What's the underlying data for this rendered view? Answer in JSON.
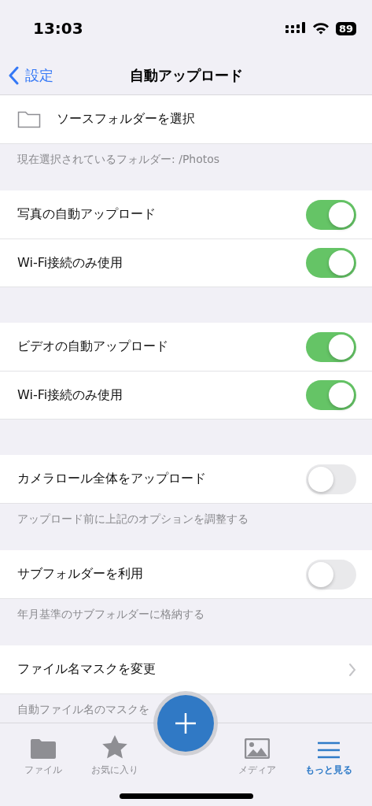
{
  "status_bar": {
    "time": "13:03",
    "battery": "89"
  },
  "nav": {
    "back": "設定",
    "title": "自動アップロード"
  },
  "sections": [
    {
      "rows": [
        {
          "kind": "folder",
          "label": "ソースフォルダーを選択"
        }
      ],
      "footer": "現在選択されているフォルダー: /Photos"
    },
    {
      "rows": [
        {
          "kind": "toggle",
          "label": "写真の自動アップロード",
          "on": true
        },
        {
          "kind": "toggle",
          "label": "Wi-Fi接続のみ使用",
          "on": true
        }
      ]
    },
    {
      "rows": [
        {
          "kind": "toggle",
          "label": "ビデオの自動アップロード",
          "on": true
        },
        {
          "kind": "toggle",
          "label": "Wi-Fi接続のみ使用",
          "on": true
        }
      ]
    },
    {
      "rows": [
        {
          "kind": "toggle",
          "label": "カメラロール全体をアップロード",
          "on": false
        }
      ],
      "footer": "アップロード前に上記のオプションを調整する"
    },
    {
      "rows": [
        {
          "kind": "toggle",
          "label": "サブフォルダーを利用",
          "on": false
        }
      ],
      "footer": "年月基準のサブフォルダーに格納する"
    },
    {
      "rows": [
        {
          "kind": "link",
          "label": "ファイル名マスクを変更"
        }
      ],
      "footer": "自動ファイル名のマスクを"
    }
  ],
  "tab_bar": {
    "items": [
      {
        "kind": "folder",
        "label": "ファイル",
        "selected": false
      },
      {
        "kind": "star",
        "label": "お気に入り",
        "selected": false
      },
      {
        "kind": "fab"
      },
      {
        "kind": "image",
        "label": "メディア",
        "selected": false
      },
      {
        "kind": "menu",
        "label": "もっと見る",
        "selected": true
      }
    ]
  }
}
